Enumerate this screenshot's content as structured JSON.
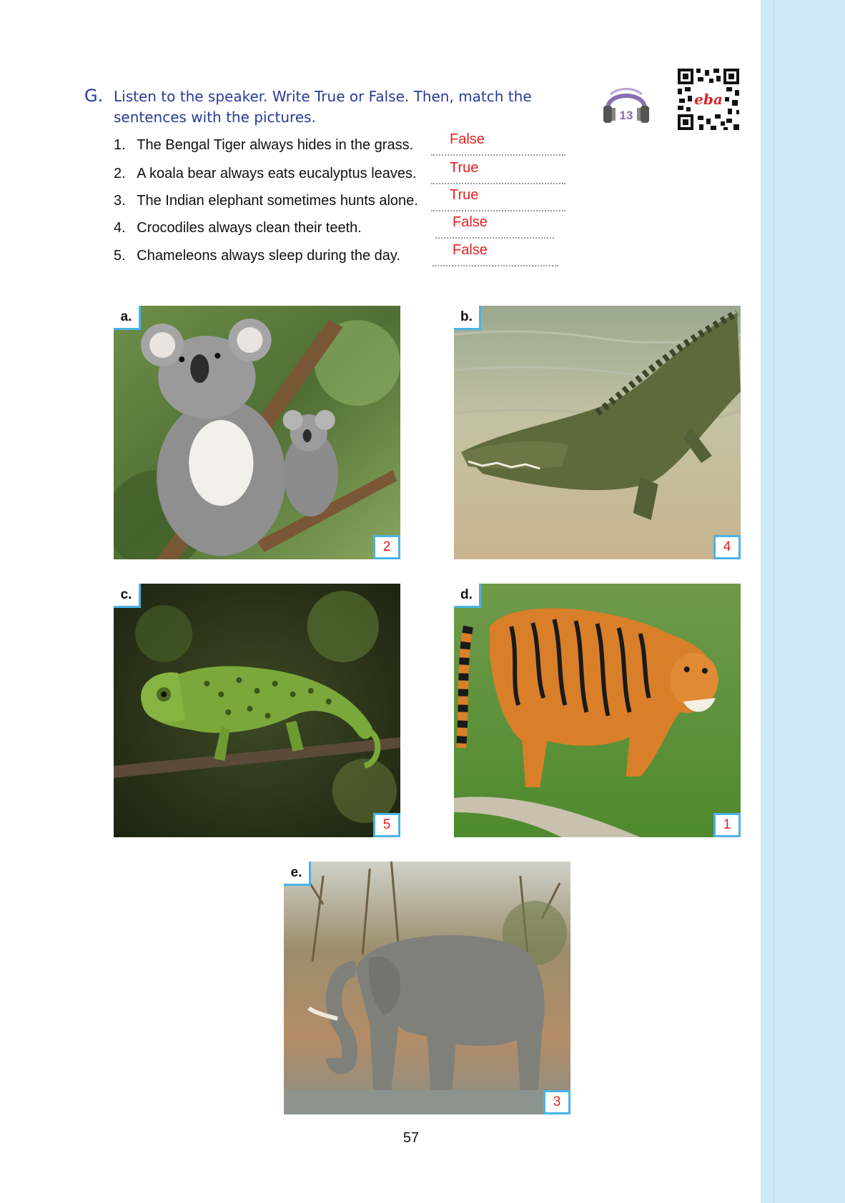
{
  "exercise": {
    "letter": "G.",
    "instructions": "Listen to the speaker. Write True or False. Then, match the sentences with the pictures.",
    "audio_track": "13",
    "qr_label": "eba"
  },
  "statements": [
    {
      "number": "1.",
      "text": "The Bengal Tiger always hides in the grass.",
      "answer": "False"
    },
    {
      "number": "2.",
      "text": "A koala bear always eats eucalyptus leaves.",
      "answer": "True"
    },
    {
      "number": "3.",
      "text": "The Indian elephant sometimes hunts alone.",
      "answer": "True"
    },
    {
      "number": "4.",
      "text": "Crocodiles always clean their teeth.",
      "answer": "False"
    },
    {
      "number": "5.",
      "text": "Chameleons always sleep during the day.",
      "answer": "False"
    }
  ],
  "pictures": [
    {
      "letter": "a.",
      "subject": "koala",
      "match": "2"
    },
    {
      "letter": "b.",
      "subject": "crocodile",
      "match": "4"
    },
    {
      "letter": "c.",
      "subject": "chameleon",
      "match": "5"
    },
    {
      "letter": "d.",
      "subject": "tiger",
      "match": "1"
    },
    {
      "letter": "e.",
      "subject": "elephant",
      "match": "3"
    }
  ],
  "page_number": "57",
  "colors": {
    "heading_blue": "#2b3a9a",
    "answer_red": "#e32020",
    "frame_blue": "#4ab3e6",
    "side_band": "#cfe9f8"
  }
}
